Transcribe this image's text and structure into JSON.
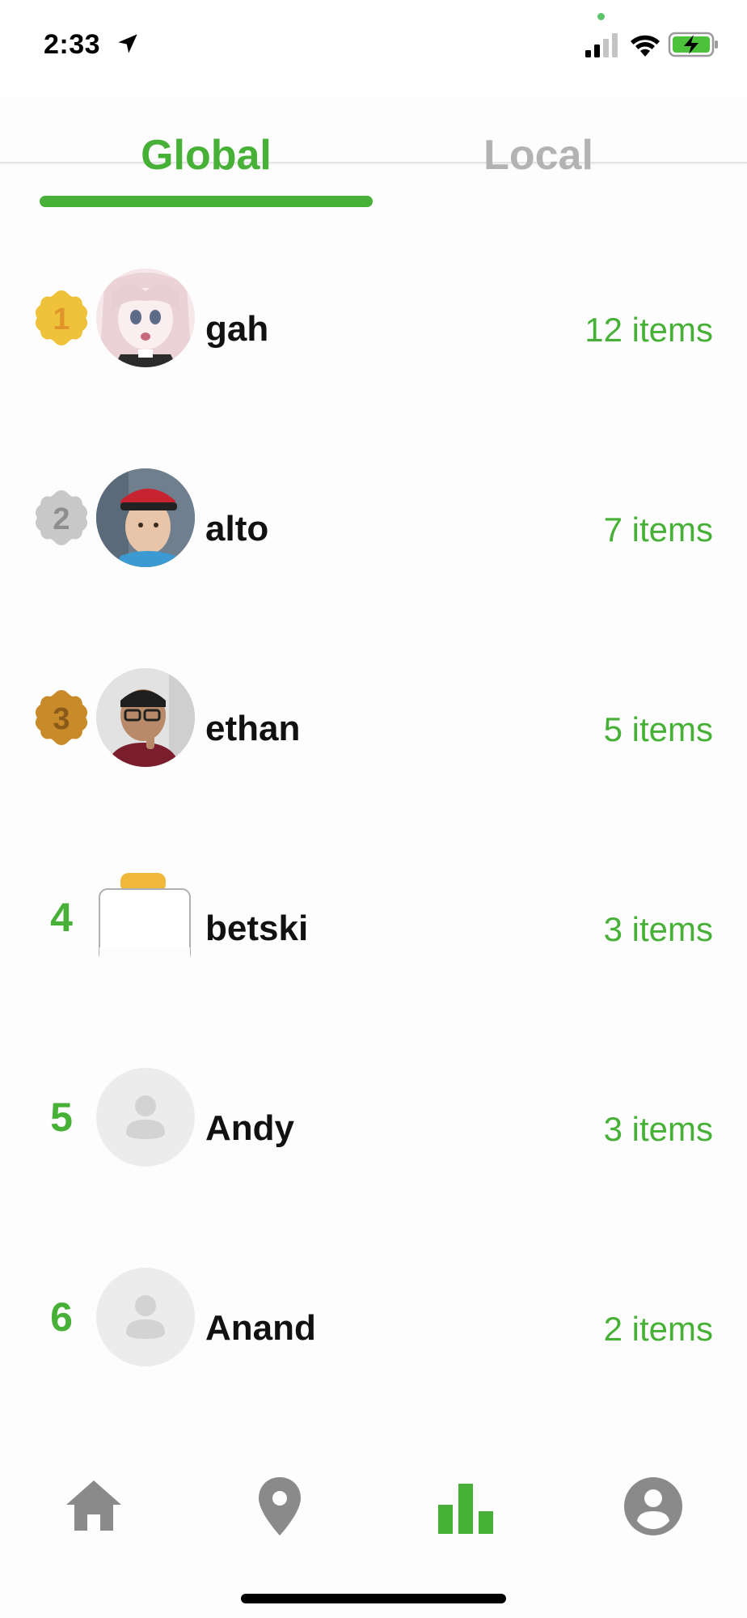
{
  "status_bar": {
    "time": "2:33"
  },
  "tabs": [
    {
      "label": "Global",
      "active": true
    },
    {
      "label": "Local",
      "active": false
    }
  ],
  "leaderboard": [
    {
      "rank": "1",
      "name": "gah",
      "count": "12 items",
      "badge": "gold"
    },
    {
      "rank": "2",
      "name": "alto",
      "count": "7 items",
      "badge": "silver"
    },
    {
      "rank": "3",
      "name": "ethan",
      "count": "5 items",
      "badge": "bronze"
    },
    {
      "rank": "4",
      "name": "betski",
      "count": "3 items",
      "badge": null
    },
    {
      "rank": "5",
      "name": "Andy",
      "count": "3 items",
      "badge": null
    },
    {
      "rank": "6",
      "name": "Anand",
      "count": "2 items",
      "badge": null
    }
  ],
  "bottom_nav": {
    "items": [
      {
        "icon": "home-icon",
        "active": false
      },
      {
        "icon": "map-pin-icon",
        "active": false
      },
      {
        "icon": "leaderboard-icon",
        "active": true
      },
      {
        "icon": "profile-icon",
        "active": false
      }
    ]
  },
  "colors": {
    "accent": "#47b036",
    "inactive": "#8a8a8a",
    "gold": "#f0c23b",
    "silver": "#c8c8c8",
    "bronze": "#c98a2a"
  }
}
